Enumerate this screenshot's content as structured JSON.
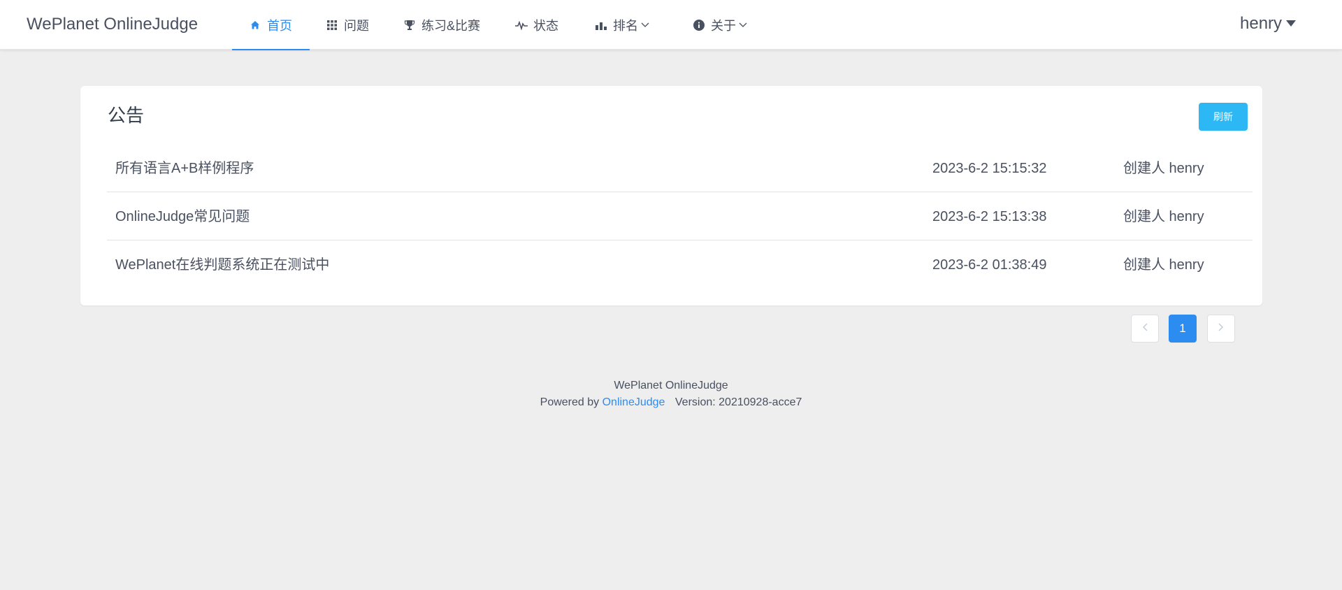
{
  "header": {
    "brand": "WePlanet OnlineJudge",
    "nav": [
      {
        "label": "首页",
        "icon": "home-icon"
      },
      {
        "label": "问题",
        "icon": "grid-icon"
      },
      {
        "label": "练习&比赛",
        "icon": "trophy-icon"
      },
      {
        "label": "状态",
        "icon": "pulse-icon"
      },
      {
        "label": "排名",
        "icon": "bar-chart-icon"
      },
      {
        "label": "关于",
        "icon": "info-icon"
      }
    ],
    "user": "henry"
  },
  "announcements": {
    "title": "公告",
    "refresh_label": "刷新",
    "items": [
      {
        "title": "所有语言A+B样例程序",
        "date": "2023-6-2 15:15:32",
        "creator": "创建人 henry"
      },
      {
        "title": "OnlineJudge常见问题",
        "date": "2023-6-2 15:13:38",
        "creator": "创建人 henry"
      },
      {
        "title": "WePlanet在线判题系统正在测试中",
        "date": "2023-6-2 01:38:49",
        "creator": "创建人 henry"
      }
    ]
  },
  "pagination": {
    "current": "1"
  },
  "footer": {
    "site": "WePlanet OnlineJudge",
    "powered_prefix": "Powered by",
    "powered_link": "OnlineJudge",
    "version": "Version: 20210928-acce7"
  },
  "colors": {
    "accent": "#2d8cf0",
    "refresh": "#2db7f5",
    "background": "#eeeeee"
  }
}
